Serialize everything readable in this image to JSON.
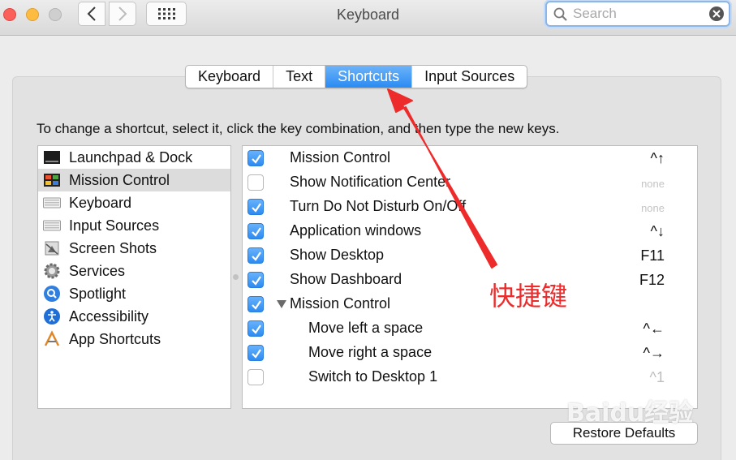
{
  "window": {
    "title": "Keyboard"
  },
  "search": {
    "placeholder": "Search"
  },
  "tabs": [
    {
      "label": "Keyboard"
    },
    {
      "label": "Text"
    },
    {
      "label": "Shortcuts"
    },
    {
      "label": "Input Sources"
    }
  ],
  "active_tab": "Shortcuts",
  "instructions": "To change a shortcut, select it, click the key combination, and then type the new keys.",
  "categories": [
    {
      "label": "Launchpad & Dock",
      "icon": "launchpad-dock-icon"
    },
    {
      "label": "Mission Control",
      "icon": "mission-control-icon"
    },
    {
      "label": "Keyboard",
      "icon": "keyboard-icon"
    },
    {
      "label": "Input Sources",
      "icon": "input-sources-icon"
    },
    {
      "label": "Screen Shots",
      "icon": "screen-shots-icon"
    },
    {
      "label": "Services",
      "icon": "services-gear-icon"
    },
    {
      "label": "Spotlight",
      "icon": "spotlight-icon"
    },
    {
      "label": "Accessibility",
      "icon": "accessibility-icon"
    },
    {
      "label": "App Shortcuts",
      "icon": "app-shortcuts-icon"
    }
  ],
  "selected_category": "Mission Control",
  "shortcuts": [
    {
      "label": "Mission Control",
      "key": "^↑",
      "checked": true
    },
    {
      "label": "Show Notification Center",
      "key": "none",
      "checked": false
    },
    {
      "label": "Turn Do Not Disturb On/Off",
      "key": "none",
      "checked": true
    },
    {
      "label": "Application windows",
      "key": "^↓",
      "checked": true
    },
    {
      "label": "Show Desktop",
      "key": "F11",
      "checked": true
    },
    {
      "label": "Show Dashboard",
      "key": "F12",
      "checked": true
    },
    {
      "label": "Mission Control",
      "key": "",
      "checked": true
    },
    {
      "label": "Move left a space",
      "key": "^←",
      "checked": true
    },
    {
      "label": "Move right a space",
      "key": "^→",
      "checked": true
    },
    {
      "label": "Switch to Desktop 1",
      "key": "^1",
      "checked": false
    }
  ],
  "restore_defaults": "Restore Defaults",
  "annotation": {
    "text": "快捷键",
    "color": "#ee2b2b"
  },
  "watermark": "Baidu经验",
  "colors": {
    "accent": "#2a8bf2",
    "annotation_red": "#ee2b2b"
  }
}
